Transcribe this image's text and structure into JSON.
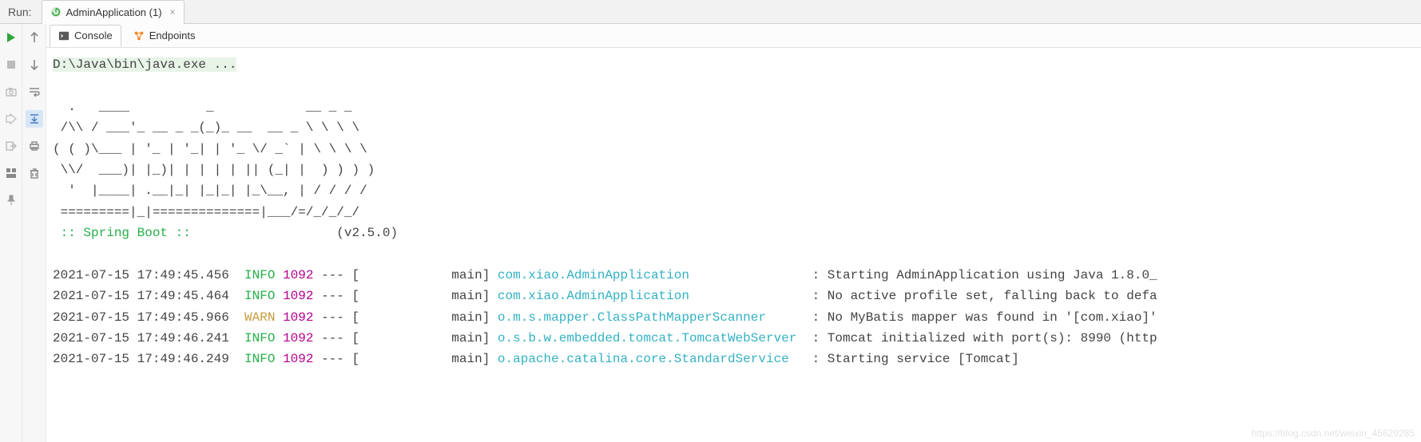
{
  "topbar": {
    "run_label": "Run:",
    "tab_title": "AdminApplication (1)"
  },
  "subtabs": {
    "console": "Console",
    "endpoints": "Endpoints"
  },
  "gutter_a": {
    "icons": [
      "play-icon",
      "stop-icon",
      "camera-icon",
      "debug-icon",
      "exit-icon",
      "layout-icon",
      "pin-icon"
    ]
  },
  "gutter_b": {
    "icons": [
      "arrow-up-icon",
      "arrow-down-icon",
      "wrap-icon",
      "scroll-end-icon",
      "print-icon",
      "trash-icon"
    ]
  },
  "console": {
    "command": "D:\\Java\\bin\\java.exe ...",
    "banner": [
      "  .   ____          _            __ _ _",
      " /\\\\ / ___'_ __ _ _(_)_ __  __ _ \\ \\ \\ \\",
      "( ( )\\___ | '_ | '_| | '_ \\/ _` | \\ \\ \\ \\",
      " \\\\/  ___)| |_)| | | | | || (_| |  ) ) ) )",
      "  '  |____| .__|_| |_|_| |_\\__, | / / / /",
      " =========|_|==============|___/=/_/_/_/"
    ],
    "spring_label": " :: Spring Boot :: ",
    "spring_version": "(v2.5.0)",
    "pid": "1092",
    "logs": [
      {
        "ts": "2021-07-15 17:49:45.456",
        "level": "INFO",
        "thread": "main",
        "cls": "com.xiao.AdminApplication",
        "msg": "Starting AdminApplication using Java 1.8.0_"
      },
      {
        "ts": "2021-07-15 17:49:45.464",
        "level": "INFO",
        "thread": "main",
        "cls": "com.xiao.AdminApplication",
        "msg": "No active profile set, falling back to defa"
      },
      {
        "ts": "2021-07-15 17:49:45.966",
        "level": "WARN",
        "thread": "main",
        "cls": "o.m.s.mapper.ClassPathMapperScanner",
        "msg": "No MyBatis mapper was found in '[com.xiao]'"
      },
      {
        "ts": "2021-07-15 17:49:46.241",
        "level": "INFO",
        "thread": "main",
        "cls": "o.s.b.w.embedded.tomcat.TomcatWebServer",
        "msg": "Tomcat initialized with port(s): 8990 (http"
      },
      {
        "ts": "2021-07-15 17:49:46.249",
        "level": "INFO",
        "thread": "main",
        "cls": "o.apache.catalina.core.StandardService",
        "msg": "Starting service [Tomcat]"
      }
    ]
  },
  "watermark": "https://blog.csdn.net/weixin_45629285"
}
